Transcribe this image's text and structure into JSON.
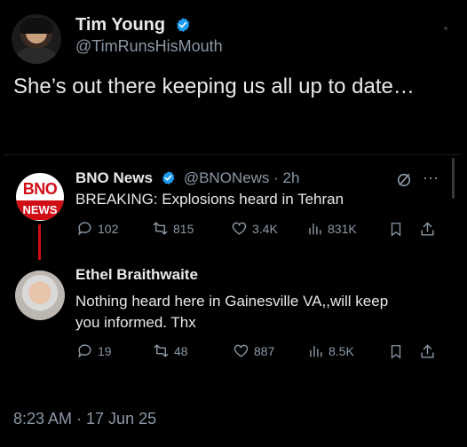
{
  "header": {
    "name": "Tim Young",
    "handle": "@TimRunsHisMouth"
  },
  "tweet_text": "She’s out there keeping us all up to date…",
  "quoted": {
    "logo_top": "BNO",
    "logo_bottom": "NEWS",
    "name": "BNO News",
    "handle_time": "@BNONews · 2h",
    "text": "BREAKING: Explosions heard in Tehran",
    "stats": {
      "replies": "102",
      "retweets": "815",
      "likes": "3.4K",
      "views": "831K"
    }
  },
  "reply": {
    "name": "Ethel Braithwaite",
    "text_line1": "Nothing heard here in Gainesville VA,,will keep",
    "text_line2": "you informed. Thx",
    "stats": {
      "replies": "19",
      "retweets": "48",
      "likes": "887",
      "views": "8.5K"
    }
  },
  "timestamp": "8:23 AM · 17 Jun 25",
  "colors": {
    "accent_blue": "#1d9bf0",
    "bno_red": "#d10e16",
    "muted": "#8b98a5"
  }
}
